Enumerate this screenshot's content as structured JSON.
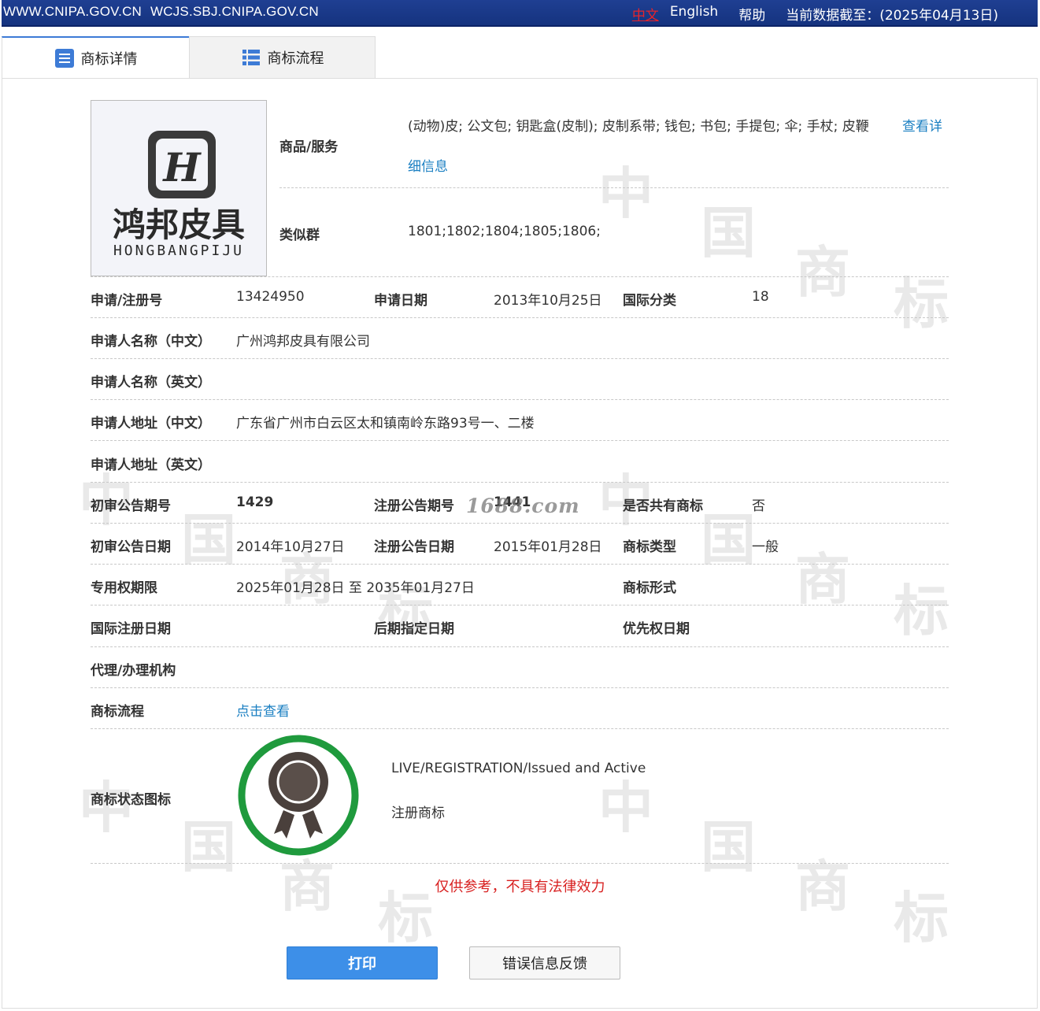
{
  "topbar": {
    "sites": [
      "WWW.CNIPA.GOV.CN",
      "WCJS.SBJ.CNIPA.GOV.CN"
    ],
    "lang_zh": "中文",
    "lang_en": "English",
    "help": "帮助",
    "data_date": "当前数据截至：(2025年04月13日)"
  },
  "tabs": {
    "detail": "商标详情",
    "flow": "商标流程"
  },
  "logo": {
    "text_cn": "鸿邦皮具",
    "text_py": "HONGBANGPIJU"
  },
  "goods": {
    "label": "商品/服务",
    "value": "(动物)皮; 公文包; 钥匙盒(皮制); 皮制系带; 钱包; 书包; 手提包; 伞; 手杖; 皮鞭",
    "more_link_1": "查看详",
    "more_link_2": "细信息"
  },
  "similar": {
    "label": "类似群",
    "value": "1801;1802;1804;1805;1806;"
  },
  "fields": {
    "reg_no_label": "申请/注册号",
    "reg_no": "13424950",
    "app_date_label": "申请日期",
    "app_date": "2013年10月25日",
    "intl_class_label": "国际分类",
    "intl_class": "18",
    "applicant_cn_label": "申请人名称（中文）",
    "applicant_cn": "广州鸿邦皮具有限公司",
    "applicant_en_label": "申请人名称（英文）",
    "address_cn_label": "申请人地址（中文）",
    "address_cn": "广东省广州市白云区太和镇南岭东路93号一、二楼",
    "address_en_label": "申请人地址（英文）",
    "prelim_no_label": "初审公告期号",
    "prelim_no": "1429",
    "reg_ann_no_label": "注册公告期号",
    "reg_ann_no": "1441",
    "shared_label": "是否共有商标",
    "shared": "否",
    "prelim_date_label": "初审公告日期",
    "prelim_date": "2014年10月27日",
    "reg_ann_date_label": "注册公告日期",
    "reg_ann_date": "2015年01月28日",
    "mark_type_label": "商标类型",
    "mark_type": "一般",
    "term_label": "专用权期限",
    "term": "2025年01月28日 至 2035年01月27日",
    "mark_form_label": "商标形式",
    "intl_reg_date_label": "国际注册日期",
    "later_designation_label": "后期指定日期",
    "priority_date_label": "优先权日期",
    "agent_label": "代理/办理机构",
    "flow_label": "商标流程",
    "flow_link": "点击查看",
    "status_label": "商标状态图标",
    "status_en": "LIVE/REGISTRATION/Issued and Active",
    "status_cn": "注册商标"
  },
  "watermark_site": "1688.com",
  "watermark_chars": [
    "中",
    "国",
    "商",
    "标"
  ],
  "disclaimer": "仅供参考，不具有法律效力",
  "buttons": {
    "print": "打印",
    "feedback": "错误信息反馈"
  },
  "colors": {
    "topbar": "#1f3f92",
    "link": "#1a7fc2",
    "accent": "#3d8fe8",
    "status_ring": "#1f9a3d",
    "warning": "#d82020"
  }
}
